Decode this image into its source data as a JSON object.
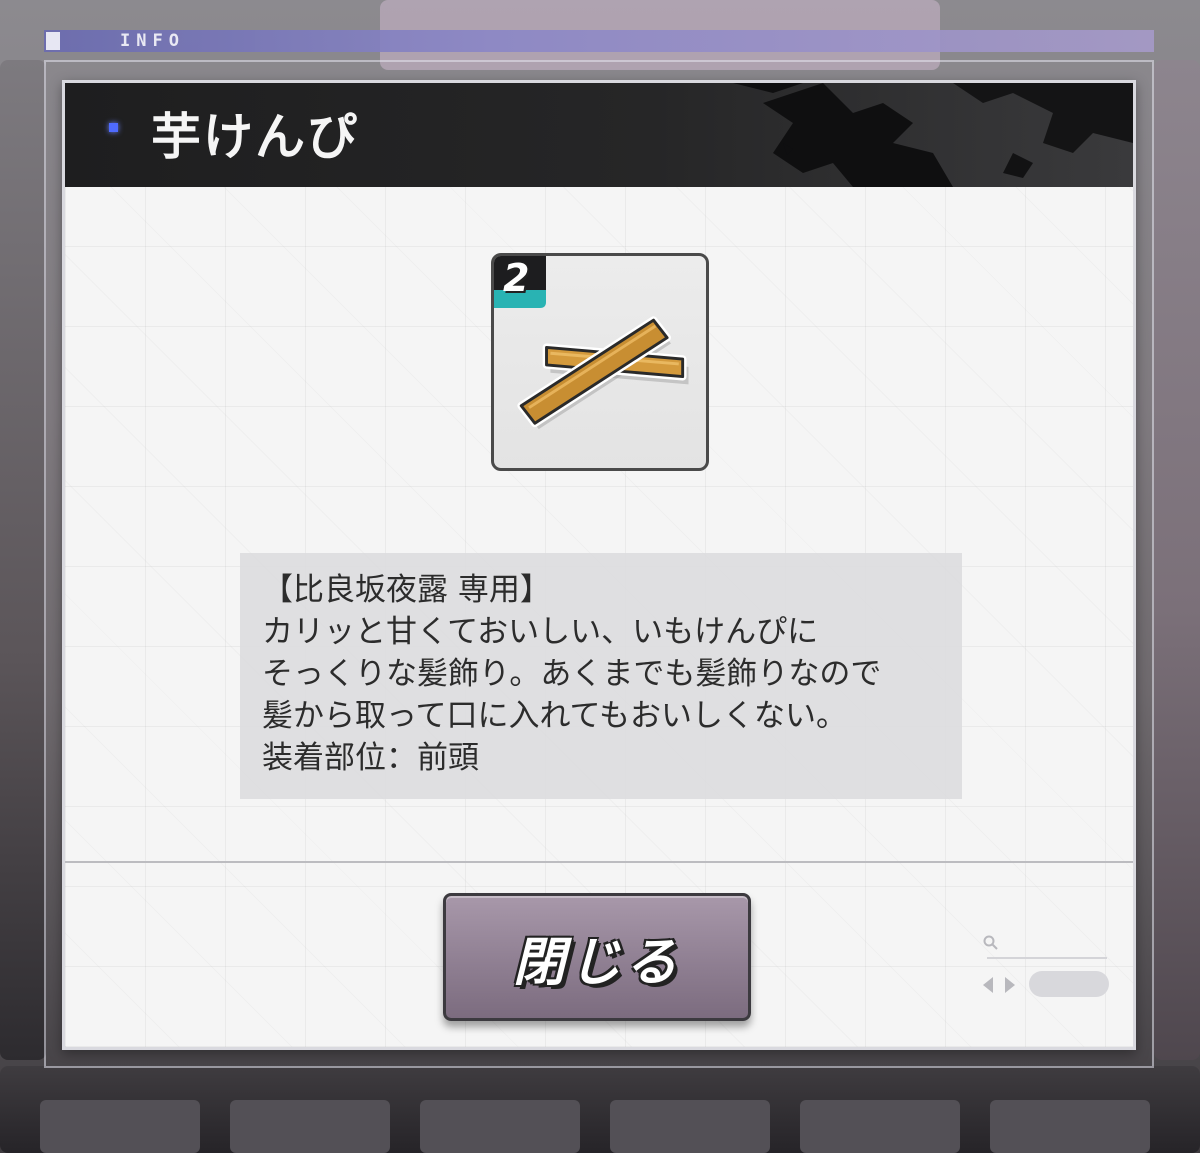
{
  "header": {
    "label": "INFO"
  },
  "dialog": {
    "title": "芋けんぴ",
    "item": {
      "rank": "2",
      "icon": "imokenpi-stick-icon"
    },
    "description": [
      "【比良坂夜露 専用】",
      "カリッと甘くておいしい、いもけんぴに",
      "そっくりな髪飾り。あくまでも髪飾りなので",
      "髪から取って口に入れてもおいしくない。",
      "装着部位：前頭"
    ],
    "close_label": "閉じる"
  },
  "colors": {
    "title_bar": "#1e1e1f",
    "accent_dot": "#4f6bff",
    "rank_badge": "#29b3b3",
    "button": "#8f7f92",
    "info_bar": "#8a86c6"
  }
}
